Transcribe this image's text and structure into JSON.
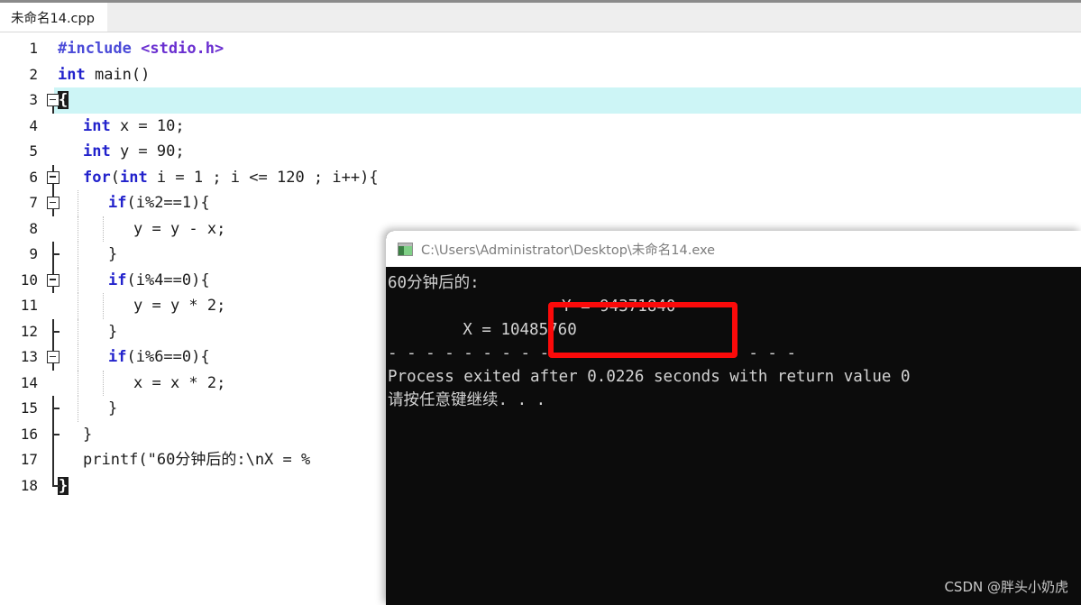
{
  "window": {
    "tab_label": "未命名14.cpp"
  },
  "editor": {
    "lines": [
      {
        "n": "1",
        "indent": 0,
        "text": "#include <stdio.h>"
      },
      {
        "n": "2",
        "indent": 0,
        "text": "int main()"
      },
      {
        "n": "3",
        "indent": 0,
        "text": "{"
      },
      {
        "n": "4",
        "indent": 1,
        "text": "int x = 10;"
      },
      {
        "n": "5",
        "indent": 1,
        "text": "int y = 90;"
      },
      {
        "n": "6",
        "indent": 1,
        "text": "for(int i = 1 ; i <= 120 ; i++){"
      },
      {
        "n": "7",
        "indent": 2,
        "text": "if(i%2==1){"
      },
      {
        "n": "8",
        "indent": 3,
        "text": "y = y - x;"
      },
      {
        "n": "9",
        "indent": 2,
        "text": "}"
      },
      {
        "n": "10",
        "indent": 2,
        "text": "if(i%4==0){"
      },
      {
        "n": "11",
        "indent": 3,
        "text": "y = y * 2;"
      },
      {
        "n": "12",
        "indent": 2,
        "text": "}"
      },
      {
        "n": "13",
        "indent": 2,
        "text": "if(i%6==0){"
      },
      {
        "n": "14",
        "indent": 3,
        "text": "x = x * 2;"
      },
      {
        "n": "15",
        "indent": 2,
        "text": "}"
      },
      {
        "n": "16",
        "indent": 1,
        "text": "}"
      },
      {
        "n": "17",
        "indent": 1,
        "text": "printf(\"60分钟后的:\\nX = %"
      },
      {
        "n": "18",
        "indent": 0,
        "text": "}"
      }
    ],
    "active_line": "3",
    "current_line_highlight_color": "#cdf5f6"
  },
  "console": {
    "title": "C:\\Users\\Administrator\\Desktop\\未命名14.exe",
    "icon": "console-app-icon",
    "output": {
      "heading": "60分钟后的:",
      "x_label": "X = 10485760",
      "y_label": "Y = 94371840",
      "separator": "- - - - - - - - - - - - - - - - - - - - - -",
      "exit_line": "Process exited after 0.0226 seconds with return value 0",
      "prompt": "请按任意键继续. . ."
    },
    "highlight_color": "#fb0a0a",
    "bg_color": "#0c0c0c",
    "text_color": "#d3d3d3"
  },
  "watermark": {
    "text": "CSDN @胖头小奶虎"
  }
}
